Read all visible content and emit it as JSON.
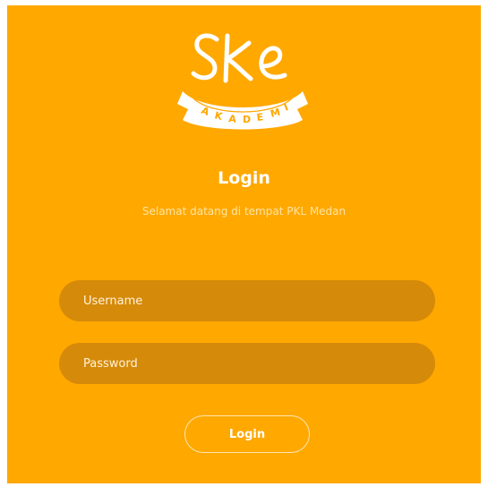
{
  "logo": {
    "wordmark": "SKe",
    "banner_text": "AKADEMI"
  },
  "header": {
    "title": "Login",
    "subtitle": "Selamat datang di tempat PKL Medan"
  },
  "form": {
    "username_placeholder": "Username",
    "username_value": "",
    "password_placeholder": "Password",
    "password_value": "",
    "submit_label": "Login"
  },
  "colors": {
    "background": "#FFA800",
    "field_fill": "#D68A0A",
    "text": "#FFFFFF"
  }
}
